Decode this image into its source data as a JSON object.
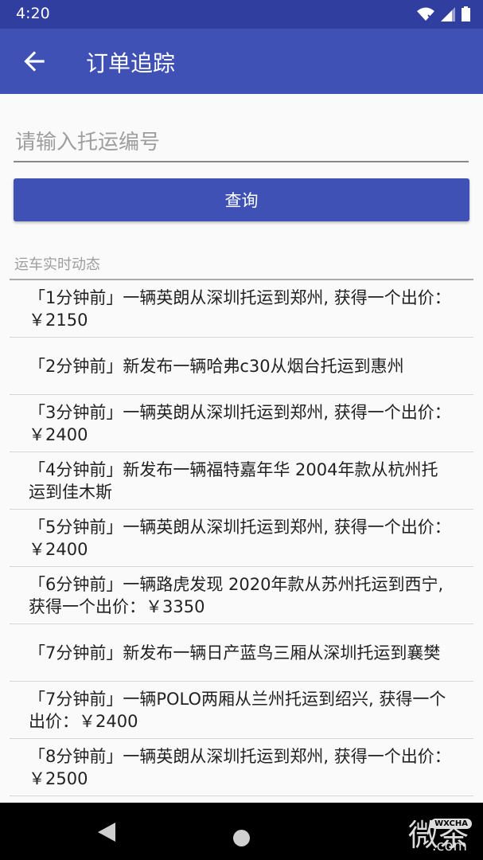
{
  "status_bar": {
    "time": "4:20"
  },
  "app_bar": {
    "title": "订单追踪"
  },
  "search": {
    "placeholder": "请输入托运编号",
    "button_label": "查询"
  },
  "feed": {
    "section_title": "运车实时动态",
    "items": [
      "「1分钟前」一辆英朗从深圳托运到郑州, 获得一个出价：￥2150",
      "「2分钟前」新发布一辆哈弗c30从烟台托运到惠州",
      "「3分钟前」一辆英朗从深圳托运到郑州, 获得一个出价：￥2400",
      "「4分钟前」新发布一辆福特嘉年华 2004年款从杭州托运到佳木斯",
      "「5分钟前」一辆英朗从深圳托运到郑州, 获得一个出价：￥2400",
      "「6分钟前」一辆路虎发现 2020年款从苏州托运到西宁, 获得一个出价：￥3350",
      "「7分钟前」新发布一辆日产蓝鸟三厢从深圳托运到襄樊",
      "「7分钟前」一辆POLO两厢从兰州托运到绍兴, 获得一个出价：￥2400",
      "「8分钟前」一辆英朗从深圳托运到郑州, 获得一个出价：￥2500"
    ]
  },
  "watermark": {
    "text": "微茶",
    "tag": "WXCHA",
    "domain": ".com"
  },
  "colors": {
    "primary": "#3f51b5",
    "primary_dark": "#303f9f"
  }
}
